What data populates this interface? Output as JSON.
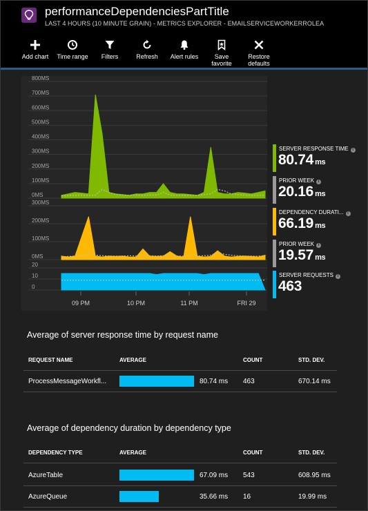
{
  "header": {
    "title": "performanceDependenciesPartTitle",
    "subtitle": "LAST 4 HOURS (10 MINUTE GRAIN) - METRICS EXPLORER - EMAILSERVICEWORKERROLEA"
  },
  "toolbar": {
    "items": [
      {
        "label": "Add chart",
        "icon": "plus-icon"
      },
      {
        "label": "Time range",
        "icon": "clock-icon"
      },
      {
        "label": "Filters",
        "icon": "funnel-icon"
      },
      {
        "label": "Refresh",
        "icon": "refresh-icon"
      },
      {
        "label": "Alert rules",
        "icon": "bell-icon"
      },
      {
        "label": "Save\nfavorite",
        "icon": "bookmark-icon"
      },
      {
        "label": "Restore\ndefaults",
        "icon": "close-icon"
      }
    ]
  },
  "colors": {
    "server_response": "#7fba00",
    "dependency": "#ffb900",
    "requests": "#00bcf2",
    "prior_week": "#9a9a9a"
  },
  "legend": {
    "server_response": {
      "name": "SERVER RESPONSE TIME",
      "value": "80.74",
      "unit": "ms"
    },
    "server_prior": {
      "name": "PRIOR WEEK",
      "value": "20.16",
      "unit": "ms"
    },
    "dependency": {
      "name": "DEPENDENCY DURATI...",
      "value": "66.19",
      "unit": "ms"
    },
    "dependency_prior": {
      "name": "PRIOR WEEK",
      "value": "19.57",
      "unit": "ms"
    },
    "requests": {
      "name": "SERVER REQUESTS",
      "value": "463",
      "unit": ""
    }
  },
  "chart_data": [
    {
      "type": "area",
      "name": "SERVER RESPONSE TIME",
      "y_ticks": [
        "800MS",
        "700MS",
        "600MS",
        "500MS",
        "400MS",
        "300MS",
        "200MS",
        "100MS",
        "0MS"
      ],
      "ylim": [
        0,
        800
      ],
      "series": [
        {
          "name": "SERVER RESPONSE TIME",
          "values": [
            20,
            30,
            40,
            35,
            30,
            710,
            440,
            40,
            30,
            25,
            20,
            30,
            30,
            40,
            40,
            100,
            40,
            30,
            30,
            25,
            20,
            40,
            350,
            40,
            30,
            30,
            40,
            35,
            30,
            40,
            50
          ]
        },
        {
          "name": "PRIOR WEEK",
          "values": [
            15,
            18,
            20,
            22,
            20,
            22,
            60,
            40,
            25,
            20,
            20,
            22,
            20,
            22,
            22,
            40,
            22,
            20,
            20,
            20,
            20,
            25,
            30,
            60,
            50,
            30,
            25,
            22,
            20,
            20,
            22
          ]
        }
      ]
    },
    {
      "type": "area",
      "name": "DEPENDENCY DURATION",
      "y_ticks": [
        "300MS",
        "200MS",
        "100MS",
        "0MS"
      ],
      "ylim": [
        0,
        300
      ],
      "series": [
        {
          "name": "DEPENDENCY DURATION",
          "values": [
            20,
            15,
            20,
            130,
            240,
            20,
            15,
            20,
            18,
            20,
            15,
            15,
            60,
            20,
            18,
            20,
            45,
            20,
            15,
            240,
            20,
            15,
            18,
            50,
            20,
            15,
            18,
            20,
            18,
            15,
            25
          ]
        },
        {
          "name": "PRIOR WEEK",
          "values": [
            15,
            18,
            20,
            22,
            35,
            25,
            22,
            20,
            20,
            20,
            22,
            20,
            22,
            22,
            20,
            22,
            20,
            20,
            20,
            22,
            20,
            22,
            25,
            40,
            30,
            25,
            22,
            20,
            20,
            20,
            22
          ]
        }
      ]
    },
    {
      "type": "area",
      "name": "SERVER REQUESTS",
      "y_ticks": [
        "20",
        "10",
        "0"
      ],
      "ylim": [
        0,
        20
      ],
      "series": [
        {
          "name": "SERVER REQUESTS",
          "values": [
            15,
            15,
            15,
            15,
            15,
            15,
            15,
            15,
            15,
            15,
            15,
            15,
            15,
            15,
            14,
            15,
            15,
            15,
            15,
            15,
            15,
            14,
            15,
            15,
            15,
            15,
            15,
            15,
            15,
            15,
            0
          ]
        },
        {
          "name": "PRIOR WEEK",
          "values": [
            9,
            9,
            9,
            9,
            9,
            9,
            9,
            9,
            9,
            9,
            9,
            9,
            9,
            9,
            9,
            9,
            9,
            9,
            9,
            9,
            9,
            9,
            9,
            9,
            9,
            9,
            9,
            9,
            9,
            9,
            9
          ]
        }
      ]
    }
  ],
  "x_axis": {
    "labels": [
      "09 PM",
      "10 PM",
      "11 PM",
      "FRI 29"
    ]
  },
  "table1": {
    "title": "Average of server response time by request name",
    "headers": [
      "REQUEST NAME",
      "AVERAGE",
      "COUNT",
      "STD. DEV."
    ],
    "rows": [
      {
        "name": "ProcessMessageWorkfl...",
        "average": "80.74 ms",
        "fraction": 1.0,
        "count": "463",
        "std": "670.14 ms"
      }
    ]
  },
  "table2": {
    "title": "Average of dependency duration by dependency type",
    "headers": [
      "DEPENDENCY TYPE",
      "AVERAGE",
      "COUNT",
      "STD. DEV."
    ],
    "rows": [
      {
        "name": "AzureTable",
        "average": "67.09 ms",
        "fraction": 1.0,
        "count": "543",
        "std": "608.95 ms"
      },
      {
        "name": "AzureQueue",
        "average": "35.66 ms",
        "fraction": 0.53,
        "count": "16",
        "std": "19.99 ms"
      }
    ]
  }
}
